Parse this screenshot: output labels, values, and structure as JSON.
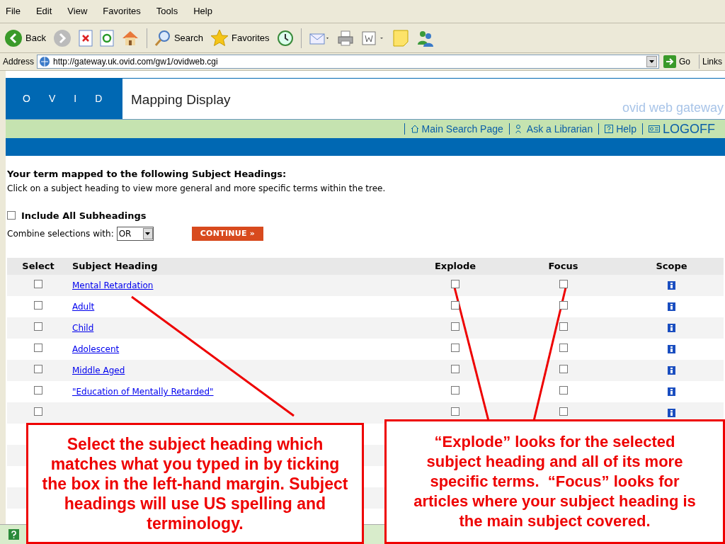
{
  "menu": [
    "File",
    "Edit",
    "View",
    "Favorites",
    "Tools",
    "Help"
  ],
  "toolbar": {
    "back": "Back",
    "search": "Search",
    "favorites": "Favorites"
  },
  "address": {
    "label": "Address",
    "url": "http://gateway.uk.ovid.com/gw1/ovidweb.cgi",
    "go": "Go",
    "links": "Links"
  },
  "header": {
    "logo": [
      "O",
      "V",
      "I",
      "D"
    ],
    "title": "Mapping Display",
    "tagline": "ovid web gateway"
  },
  "nav": [
    {
      "label": "Main Search Page",
      "kind": "home"
    },
    {
      "label": "Ask a Librarian",
      "kind": "librarian"
    },
    {
      "label": "Help",
      "kind": "help"
    },
    {
      "label": "LOGOFF",
      "kind": "logoff"
    }
  ],
  "intro": {
    "heading": "Your term mapped to the following Subject Headings:",
    "text": "Click on a subject heading to view more general and more specific terms within the tree."
  },
  "options": {
    "include_all": {
      "label": "Include All Subheadings",
      "checked": false
    },
    "combine": {
      "label": "Combine selections with:",
      "value": "OR"
    },
    "continue": "CONTINUE »"
  },
  "table": {
    "columns": [
      "Select",
      "Subject Heading",
      "Explode",
      "Focus",
      "Scope"
    ],
    "rows": [
      {
        "heading": "Mental Retardation",
        "select": false,
        "explode": false,
        "focus": false
      },
      {
        "heading": "Adult",
        "select": false,
        "explode": false,
        "focus": false
      },
      {
        "heading": "Child",
        "select": false,
        "explode": false,
        "focus": false
      },
      {
        "heading": "Adolescent",
        "select": false,
        "explode": false,
        "focus": false
      },
      {
        "heading": "Middle Aged",
        "select": false,
        "explode": false,
        "focus": false
      },
      {
        "heading": "\"Education of Mentally Retarded\"",
        "select": false,
        "explode": false,
        "focus": false
      },
      {
        "select": false,
        "explode": false,
        "focus": false
      }
    ]
  },
  "callouts": [
    "Select the subject heading which matches what you typed in by ticking the box in the left-hand margin. Subject headings will use US spelling and terminology.",
    "“Explode” looks for the selected subject heading and all of its more specific terms.  “Focus” looks for articles where your subject heading is the main subject covered."
  ]
}
